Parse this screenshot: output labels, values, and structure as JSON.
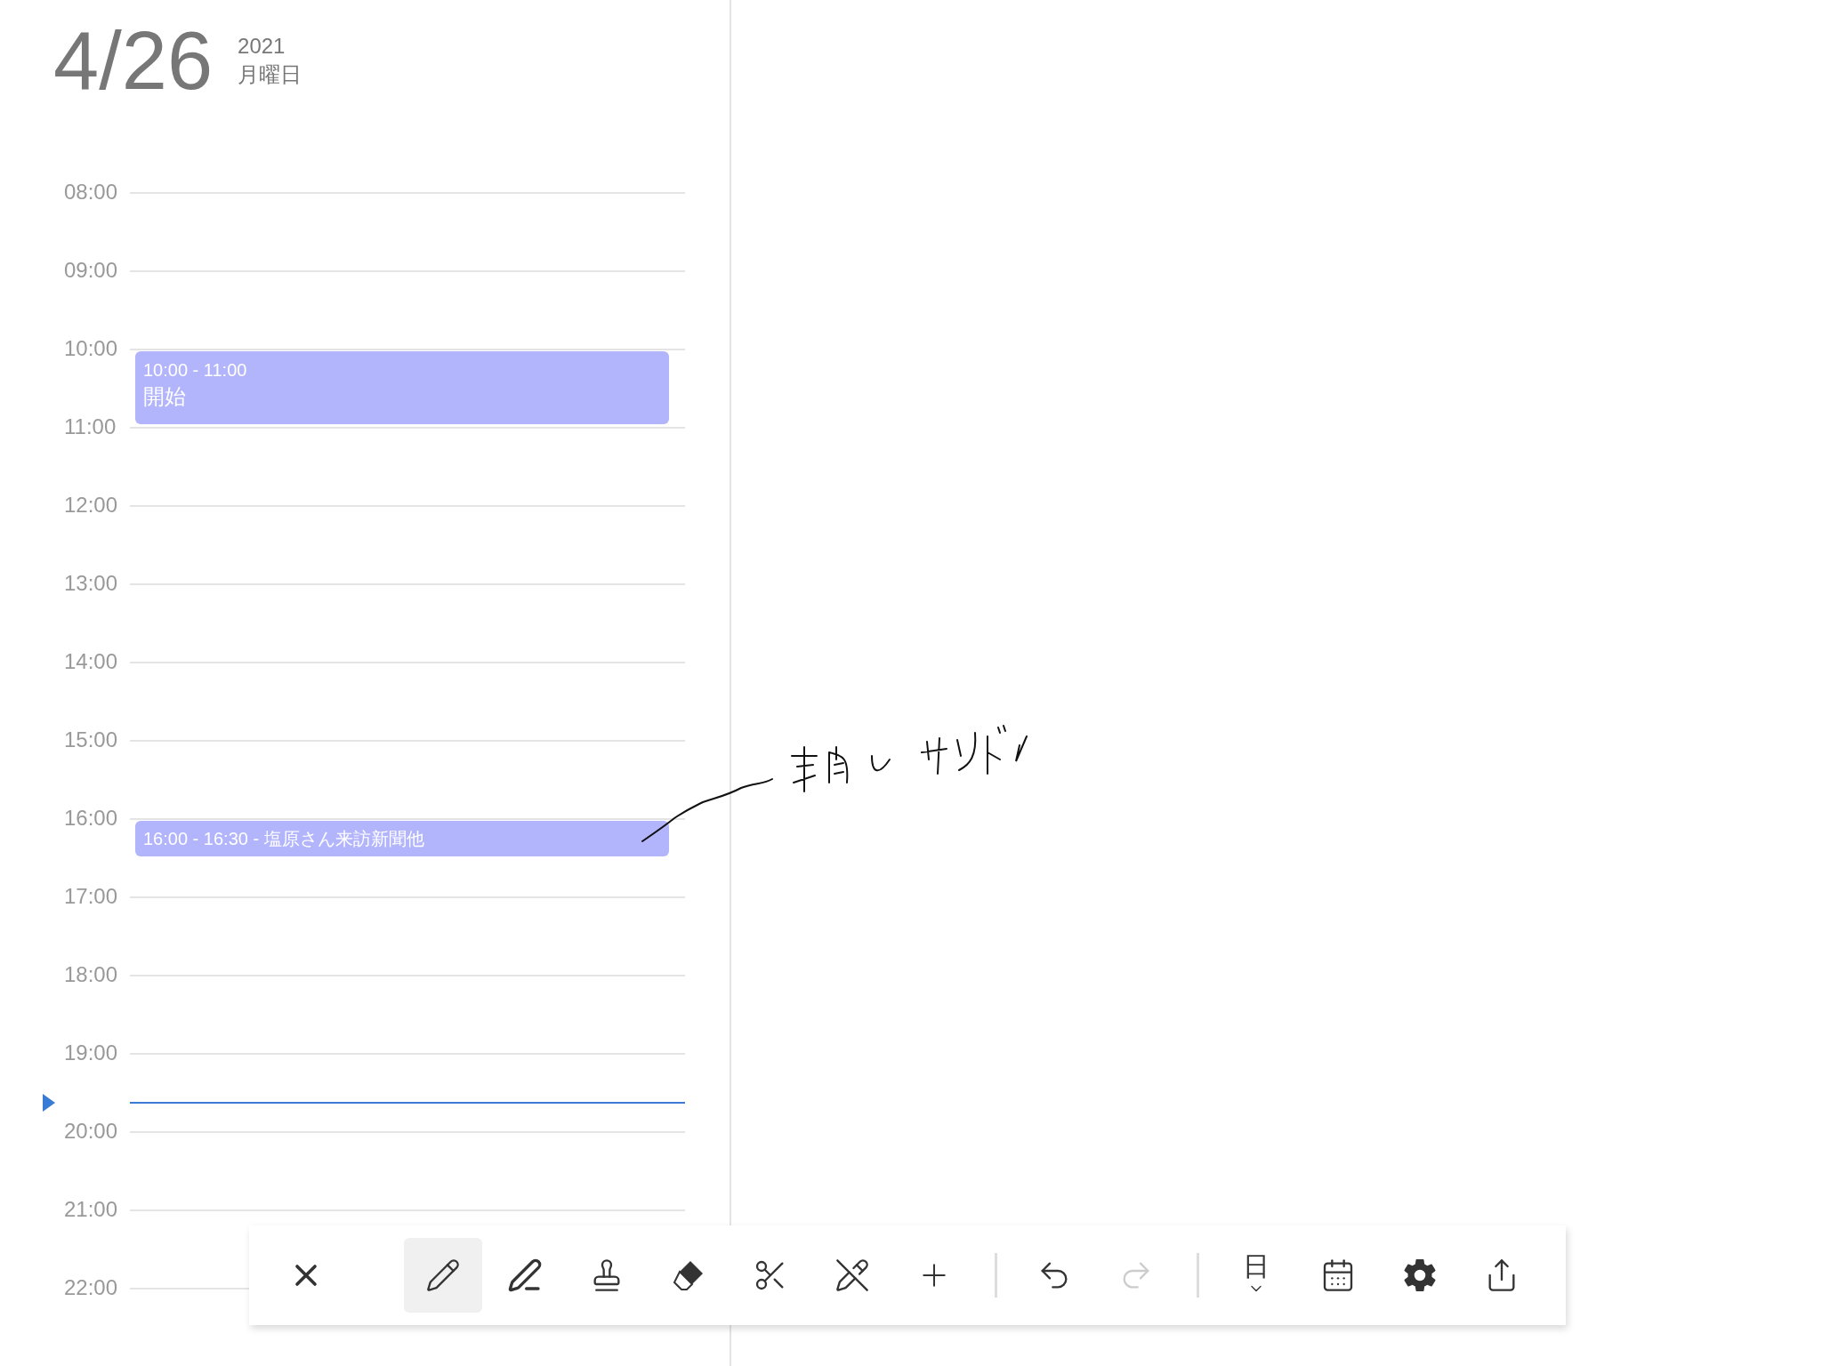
{
  "header": {
    "day": "4/26",
    "year": "2021",
    "weekday": "月曜日"
  },
  "hours": [
    {
      "label": "08:00"
    },
    {
      "label": "09:00"
    },
    {
      "label": "10:00",
      "events": [
        {
          "kind": "block",
          "time": "10:00 - 11:00",
          "title": "開始",
          "color": "#b3b5fc"
        }
      ]
    },
    {
      "label": "11:00"
    },
    {
      "label": "12:00"
    },
    {
      "label": "13:00"
    },
    {
      "label": "14:00"
    },
    {
      "label": "15:00"
    },
    {
      "label": "16:00",
      "events": [
        {
          "kind": "inline",
          "title": "16:00 - 16:30 - 塩原さん来訪新聞他",
          "color": "#b3b5fc"
        }
      ]
    },
    {
      "label": "17:00"
    },
    {
      "label": "18:00"
    },
    {
      "label": "19:00",
      "now_marker": true
    },
    {
      "label": "20:00"
    },
    {
      "label": "21:00"
    },
    {
      "label": "22:00"
    }
  ],
  "toolbar": [
    {
      "kind": "close",
      "selected": false,
      "disabled": false
    },
    {
      "kind": "gap"
    },
    {
      "kind": "pencil",
      "selected": true,
      "disabled": false
    },
    {
      "kind": "marker",
      "selected": false,
      "disabled": false
    },
    {
      "kind": "stamp",
      "selected": false,
      "disabled": false
    },
    {
      "kind": "eraser",
      "selected": false,
      "disabled": false
    },
    {
      "kind": "scissors",
      "selected": false,
      "disabled": false
    },
    {
      "kind": "pencil-cross",
      "selected": false,
      "disabled": false
    },
    {
      "kind": "plus",
      "selected": false,
      "disabled": false
    },
    {
      "kind": "separator"
    },
    {
      "kind": "undo",
      "selected": false,
      "disabled": false
    },
    {
      "kind": "redo",
      "selected": false,
      "disabled": true
    },
    {
      "kind": "separator"
    },
    {
      "kind": "view",
      "label": "日",
      "selected": false,
      "disabled": false
    },
    {
      "kind": "calendar",
      "selected": false,
      "disabled": false
    },
    {
      "kind": "settings",
      "selected": false,
      "disabled": false
    },
    {
      "kind": "share",
      "selected": false,
      "disabled": false
    }
  ]
}
